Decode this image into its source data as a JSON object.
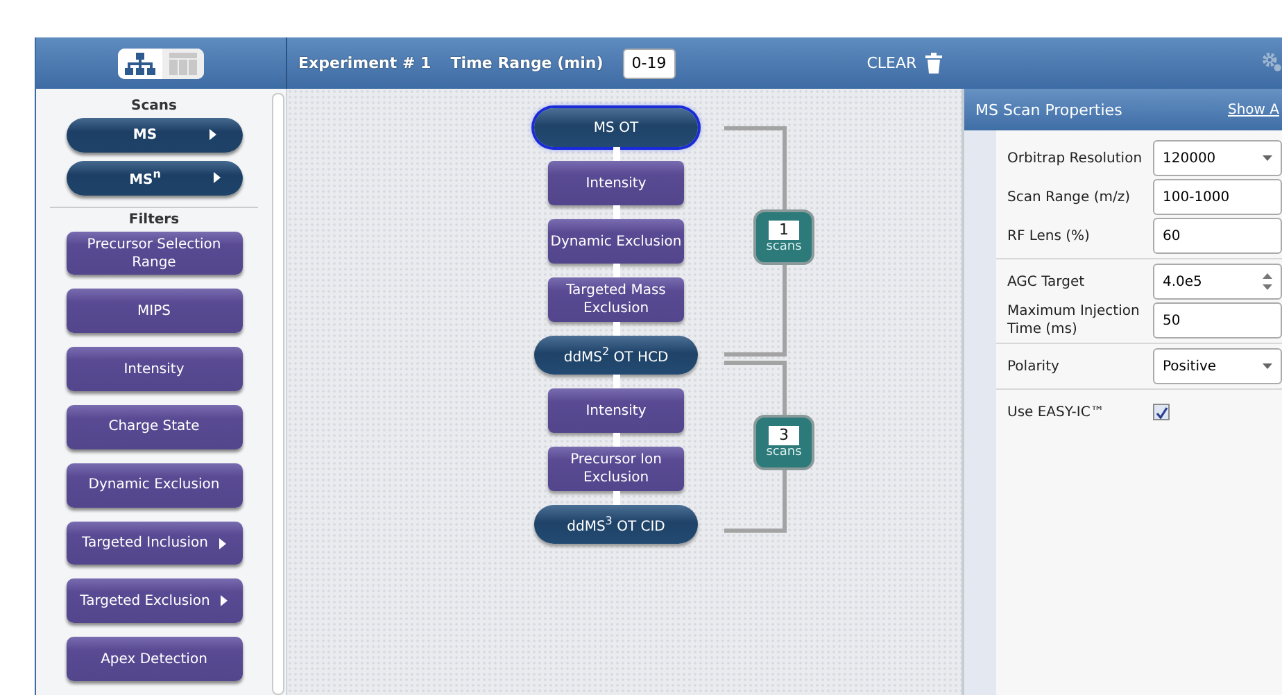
{
  "toolbar": {
    "view_toggle": [
      {
        "kind": "tree",
        "selected": true
      },
      {
        "kind": "table",
        "selected": false
      }
    ],
    "experiment": "Experiment # 1",
    "time_range_label": "Time Range (min)",
    "time_range_value": "0-19",
    "clear": "CLEAR"
  },
  "sidebar": {
    "sections": [
      {
        "title": "Scans",
        "kind": "scan",
        "items": [
          {
            "label": "MS",
            "submenu": true
          },
          {
            "label": "MS$^{n}$",
            "submenu": true
          }
        ]
      },
      {
        "title": "Filters",
        "kind": "filter",
        "items": [
          {
            "label": "Precursor Selection Range",
            "submenu": false
          },
          {
            "label": "MIPS",
            "submenu": false
          },
          {
            "label": "Intensity",
            "submenu": false
          },
          {
            "label": "Charge State",
            "submenu": false
          },
          {
            "label": "Dynamic Exclusion",
            "submenu": false
          },
          {
            "label": "Targeted Inclusion",
            "submenu": true
          },
          {
            "label": "Targeted Exclusion",
            "submenu": true
          },
          {
            "label": "Apex Detection",
            "submenu": false
          }
        ]
      }
    ]
  },
  "flow": {
    "nodes": [
      {
        "kind": "scan",
        "label": "MS OT",
        "selected": true
      },
      {
        "kind": "filter",
        "label": "Intensity",
        "selected": false
      },
      {
        "kind": "filter",
        "label": "Dynamic Exclusion",
        "selected": false
      },
      {
        "kind": "filter",
        "label": "Targeted Mass Exclusion",
        "selected": false
      },
      {
        "kind": "scan",
        "label": "ddMS$^{2}$ OT HCD",
        "selected": false
      },
      {
        "kind": "filter",
        "label": "Intensity",
        "selected": false
      },
      {
        "kind": "filter",
        "label": "Precursor Ion Exclusion",
        "selected": false
      },
      {
        "kind": "scan",
        "label": "ddMS$^{3}$ OT CID",
        "selected": false
      }
    ],
    "brackets": [
      {
        "count": "1",
        "unit": "scans"
      },
      {
        "count": "3",
        "unit": "scans"
      }
    ]
  },
  "properties": {
    "title": "MS Scan Properties",
    "link": "Show A",
    "groups": [
      [
        {
          "label": "Orbitrap Resolution",
          "kind": "select",
          "value": "120000"
        },
        {
          "label": "Scan Range (m/z)",
          "kind": "text",
          "value": "100-1000"
        },
        {
          "label": "RF Lens (%)",
          "kind": "text",
          "value": "60"
        }
      ],
      [
        {
          "label": "AGC Target",
          "kind": "spin",
          "value": "4.0e5"
        },
        {
          "label": "Maximum Injection Time (ms)",
          "kind": "text",
          "value": "50"
        }
      ],
      [
        {
          "label": "Polarity",
          "kind": "select",
          "value": "Positive"
        }
      ],
      [
        {
          "label": "Use EASY-IC™",
          "kind": "checkbox",
          "checked": true
        }
      ]
    ]
  }
}
